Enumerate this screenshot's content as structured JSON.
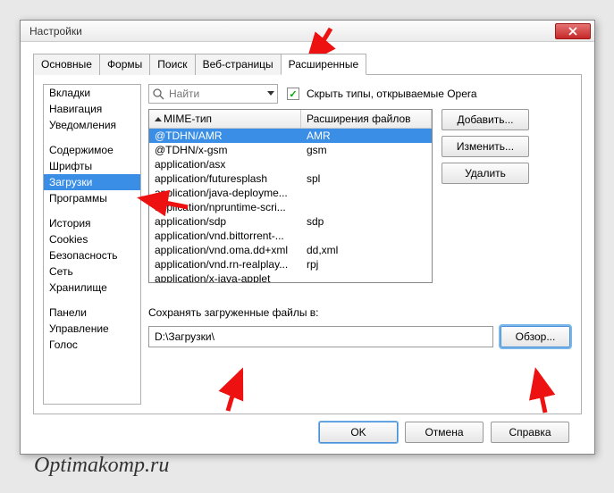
{
  "window": {
    "title": "Настройки"
  },
  "tabs": [
    "Основные",
    "Формы",
    "Поиск",
    "Веб-страницы",
    "Расширенные"
  ],
  "activeTab": 4,
  "sidebar": {
    "groups": [
      [
        "Вкладки",
        "Навигация",
        "Уведомления"
      ],
      [
        "Содержимое",
        "Шрифты",
        "Загрузки",
        "Программы"
      ],
      [
        "История",
        "Cookies",
        "Безопасность",
        "Сеть",
        "Хранилище"
      ],
      [
        "Панели",
        "Управление",
        "Голос"
      ]
    ],
    "selected": "Загрузки"
  },
  "search": {
    "placeholder": "Найти"
  },
  "hideTypes": {
    "label": "Скрыть типы, открываемые Opera",
    "checked": true
  },
  "table": {
    "cols": [
      "MIME-тип",
      "Расширения файлов"
    ],
    "rows": [
      {
        "mime": "@TDHN/AMR",
        "ext": "AMR",
        "selected": true
      },
      {
        "mime": "@TDHN/x-gsm",
        "ext": "gsm"
      },
      {
        "mime": "application/asx",
        "ext": ""
      },
      {
        "mime": "application/futuresplash",
        "ext": "spl"
      },
      {
        "mime": "application/java-deployme...",
        "ext": ""
      },
      {
        "mime": "application/npruntime-scri...",
        "ext": ""
      },
      {
        "mime": "application/sdp",
        "ext": "sdp"
      },
      {
        "mime": "application/vnd.bittorrent-...",
        "ext": ""
      },
      {
        "mime": "application/vnd.oma.dd+xml",
        "ext": "dd,xml"
      },
      {
        "mime": "application/vnd.rn-realplay...",
        "ext": "rpj"
      },
      {
        "mime": "application/x-java-applet",
        "ext": ""
      }
    ]
  },
  "buttons": {
    "add": "Добавить...",
    "edit": "Изменить...",
    "del": "Удалить"
  },
  "save": {
    "label": "Сохранять загруженные файлы в:",
    "path": "D:\\Загрузки\\",
    "browse": "Обзор..."
  },
  "dialog": {
    "ok": "OK",
    "cancel": "Отмена",
    "help": "Справка"
  },
  "watermark": "Optimakomp.ru"
}
